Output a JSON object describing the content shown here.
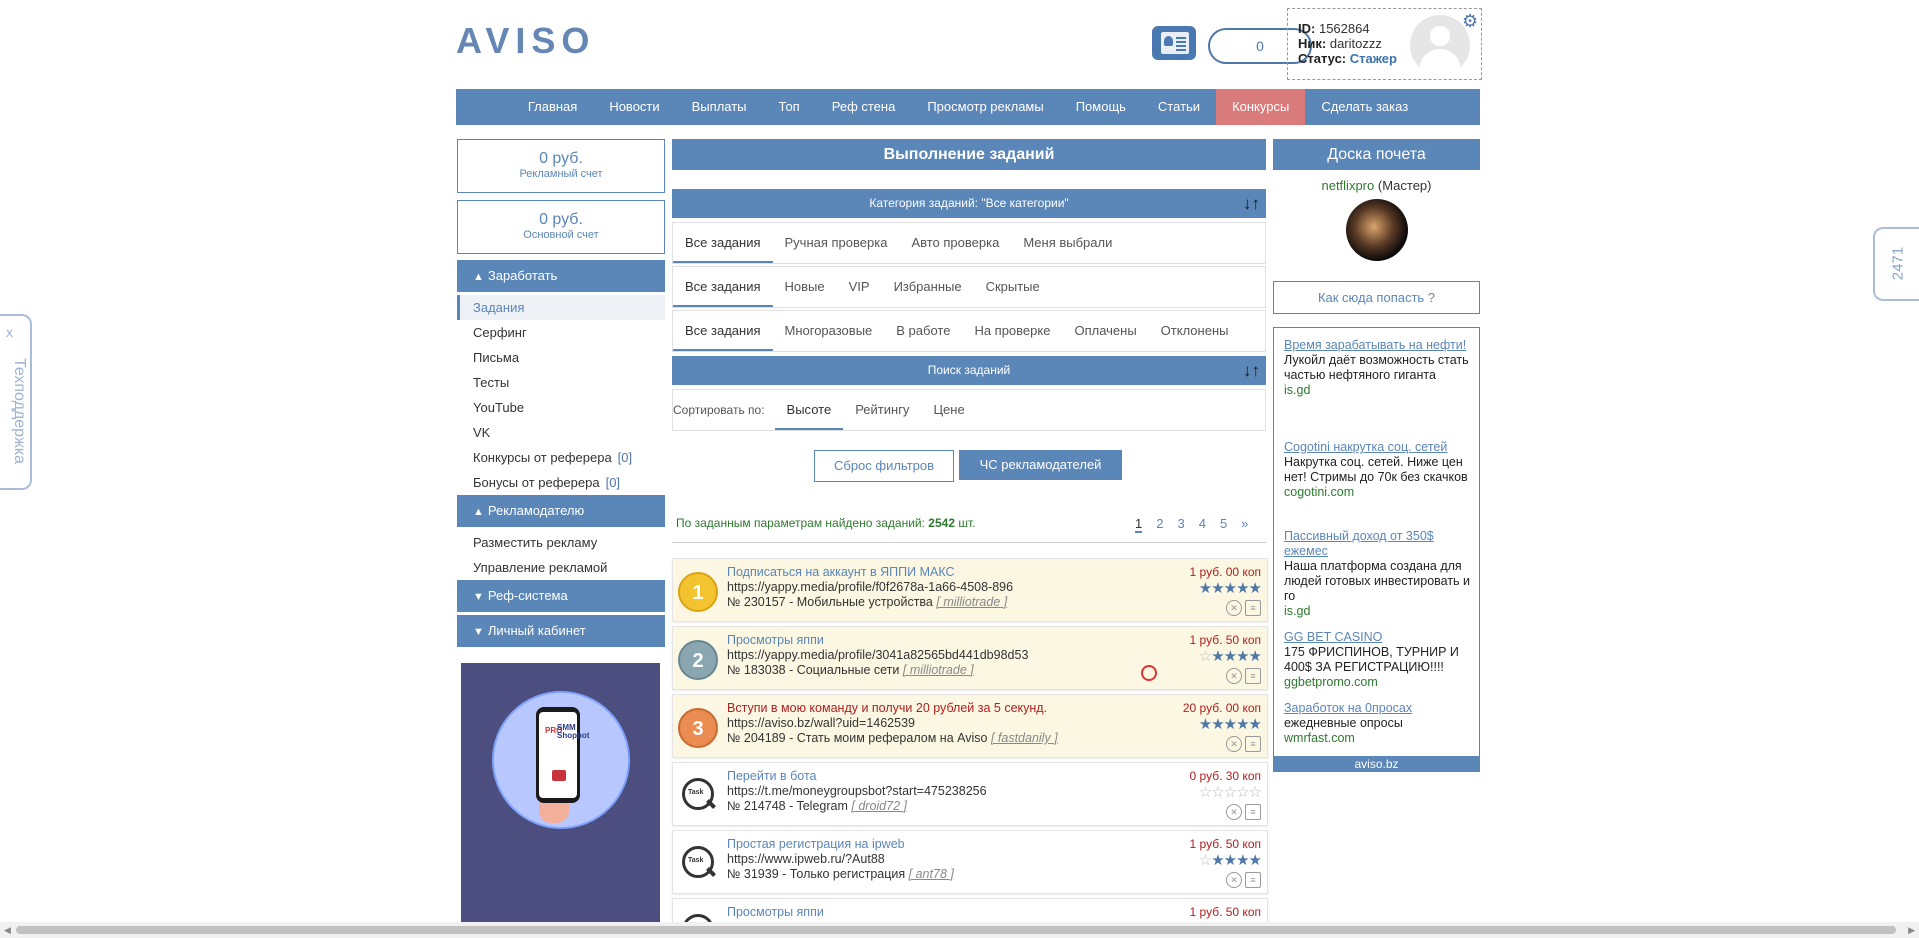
{
  "header": {
    "logo": "AVISO",
    "counter": "0",
    "user": {
      "id_label": "ID:",
      "id": "1562864",
      "nick_label": "Ник:",
      "nick": "daritozzz",
      "status_label": "Статус:",
      "status": "Стажер"
    }
  },
  "nav": [
    {
      "label": "Главная"
    },
    {
      "label": "Новости"
    },
    {
      "label": "Выплаты"
    },
    {
      "label": "Топ"
    },
    {
      "label": "Реф стена"
    },
    {
      "label": "Просмотр рекламы"
    },
    {
      "label": "Помощь"
    },
    {
      "label": "Статьи"
    },
    {
      "label": "Конкурсы",
      "active": true
    },
    {
      "label": "Сделать заказ"
    }
  ],
  "left": {
    "balance_ad": {
      "amount": "0 руб.",
      "label": "Рекламный счет"
    },
    "balance_main": {
      "amount": "0 руб.",
      "label": "Основной счет"
    },
    "sec_earn": "Заработать",
    "earn_items": [
      "Задания",
      "Серфинг",
      "Письма",
      "Тесты",
      "YouTube",
      "VK",
      "Конкурсы от реферера",
      "Бонусы от реферера"
    ],
    "earn_counts": {
      "contests": "[0]",
      "bonuses": "[0]"
    },
    "sec_adv": "Рекламодателю",
    "adv_items": [
      "Разместить рекламу",
      "Управление рекламой"
    ],
    "sec_ref": "Реф-система",
    "sec_cabinet": "Личный кабинет",
    "banner": {
      "pro": "PRO",
      "smm": "SMM",
      "shop": "Shopbot"
    }
  },
  "center": {
    "title": "Выполнение заданий",
    "category_bar": "Категория заданий: \"Все категории\"",
    "tabs1": [
      "Все задания",
      "Ручная проверка",
      "Авто проверка",
      "Меня выбрали"
    ],
    "tabs2": [
      "Все задания",
      "Новые",
      "VIP",
      "Избранные",
      "Скрытые"
    ],
    "tabs3": [
      "Все задания",
      "Многоразовые",
      "В работе",
      "На проверке",
      "Оплачены",
      "Отклонены"
    ],
    "search_bar": "Поиск заданий",
    "sort_label": "Сортировать по:",
    "sort_tabs": [
      "Высоте",
      "Рейтингу",
      "Цене"
    ],
    "btn_reset": "Сброс фильтров",
    "btn_blacklist": "ЧС рекламодателей",
    "found_prefix": "По заданным параметрам найдено заданий:",
    "found_count": "2542",
    "found_suffix": "шт.",
    "pages": [
      "1",
      "2",
      "3",
      "4",
      "5",
      "»"
    ],
    "tasks": [
      {
        "title": "Подписаться на аккаунт в ЯППИ МАКС",
        "url": "https://yappy.media/profile/f0f2678a-1a66-4508-896",
        "meta": "№ 230157 - Мобильные устройства",
        "author": "milliotrade",
        "price": "1 руб. 00 коп",
        "badge": "1",
        "stars": 5
      },
      {
        "title": "Просмотры яппи",
        "url": "https://yappy.media/profile/3041a82565bd441db98d53",
        "meta": "№ 183038 - Социальные сети",
        "author": "milliotrade",
        "price": "1 руб. 50 коп",
        "badge": "2",
        "stars": 4
      },
      {
        "title": "Вступи в мою команду и получи 20 рублей за 5 секунд.",
        "url": "https://aviso.bz/wall?uid=1462539",
        "meta": "№ 204189 - Стать моим рефералом на Aviso",
        "author": "fastdanily",
        "price": "20 руб. 00 коп",
        "badge": "3",
        "stars": 5
      },
      {
        "title": "Перейти в бота",
        "url": "https://t.me/moneygroupsbot?start=475238256",
        "meta": "№ 214748 - Telegram",
        "author": "droid72",
        "price": "0 руб. 30 коп",
        "stars": 0
      },
      {
        "title": "Простая регистрация на ipweb",
        "url": "https://www.ipweb.ru/?Aut88",
        "meta": "№ 31939 - Только регистрация",
        "author": "ant78",
        "price": "1 руб. 50 коп",
        "stars": 4
      },
      {
        "title": "Просмотры яппи",
        "url": "",
        "meta": "",
        "author": "",
        "price": "1 руб. 50 коп",
        "stars": 0
      }
    ]
  },
  "right": {
    "title": "Доска почета",
    "honor_user": "netflixpro",
    "honor_rank": "(Мастер)",
    "how_btn": "Как сюда попасть ?",
    "ads": [
      {
        "h": "Время зарабатывать на нефти!",
        "d": "Лукойл даёт возможность стать частью нефтяного гиганта",
        "s": "is.gd"
      },
      {
        "h": "Cogotini накрутка соц. сетей",
        "d": "Накрутка соц. сетей. Ниже цен нет! Стримы до 70к без скачков",
        "s": "cogotini.com"
      },
      {
        "h": "Пассивный доход от 350$ ежемес",
        "d": "Наша платформа создана для людей готовых инвестировать и го",
        "s": "is.gd"
      },
      {
        "h": "GG BET CASINO",
        "d": "175 ФРИСПИНОВ, ТУРНИР И 400$ ЗА РЕГИСТРАЦИЮ!!!!",
        "s": "ggbetpromo.com"
      },
      {
        "h": "Заработок на 0просах",
        "d": "ежедневные опросы",
        "s": "wmrfast.com"
      }
    ],
    "ads_footer": "aviso.bz"
  },
  "widgets": {
    "support_x": "x",
    "support": "Техподдержка",
    "online": "2471"
  }
}
